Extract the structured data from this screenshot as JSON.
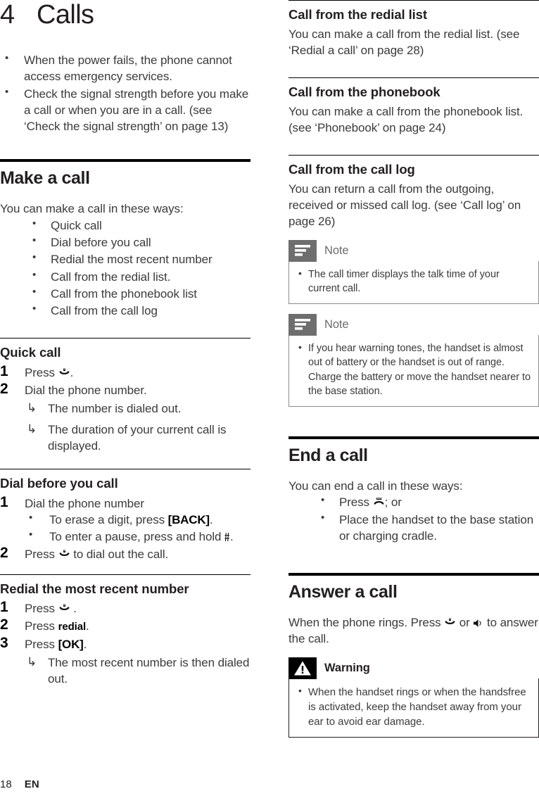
{
  "chapter": {
    "number": "4",
    "title": "Calls"
  },
  "intro_bullets": [
    "When the power fails, the phone cannot access emergency services.",
    "Check the signal strength before you make a call or when you are in a call. (see ‘Check the signal strength’ on page 13)"
  ],
  "make_a_call": {
    "heading": "Make a call",
    "intro": "You can make a call in these ways:",
    "ways": [
      "Quick call",
      "Dial before you call",
      "Redial the most recent number",
      "Call from the redial list.",
      "Call from the phonebook list",
      "Call from the call log"
    ]
  },
  "quick_call": {
    "heading": "Quick call",
    "step1_num": "1",
    "step1_a": "Press",
    "step1_b": ".",
    "step2_num": "2",
    "step2_text": "Dial the phone number.",
    "results": [
      "The number is dialed out.",
      "The duration of your current call is displayed."
    ]
  },
  "dial_before": {
    "heading": "Dial before you call",
    "step1_num": "1",
    "step1_text": "Dial the phone number",
    "sub1_a": "To erase a digit, press",
    "sub1_key": "[BACK]",
    "sub1_b": ".",
    "sub2_a": "To enter a pause, press and hold",
    "sub2_b": ".",
    "step2_num": "2",
    "step2_a": "Press",
    "step2_b": "to dial out the call."
  },
  "redial_recent": {
    "heading": "Redial the most recent number",
    "step1_num": "1",
    "step1_a": "Press",
    "step1_b": ".",
    "step2_num": "2",
    "step2_a": "Press",
    "step2_softkey": "redial",
    "step2_b": ".",
    "step3_num": "3",
    "step3_a": "Press",
    "step3_key": "[OK]",
    "step3_b": ".",
    "result": "The most recent number is then dialed out."
  },
  "redial_list": {
    "heading": "Call from the redial list",
    "body": "You can make a call from the redial list. (see ‘Redial a call’ on page 28)"
  },
  "phonebook": {
    "heading": "Call from the phonebook",
    "body": "You can make a call from the phonebook list. (see ‘Phonebook’ on page 24)"
  },
  "call_log": {
    "heading": "Call from the call log",
    "body": "You can return a call from the outgoing, received or missed call log. (see ‘Call log’ on page 26)"
  },
  "note1": {
    "label": "Note",
    "items": [
      "The call timer displays the talk time of your current call."
    ]
  },
  "note2": {
    "label": "Note",
    "items": [
      "If you hear warning tones, the handset is almost out of battery or the handset is out of range. Charge the battery or move the handset nearer to the base station."
    ]
  },
  "end_a_call": {
    "heading": "End a call",
    "intro": "You can end a call in these ways:",
    "way1_a": "Press",
    "way1_b": "; or",
    "way2": "Place the handset to the base station or charging cradle."
  },
  "answer_a_call": {
    "heading": "Answer a call",
    "body_a": "When the phone rings. Press",
    "body_or": "or",
    "body_b": "to answer the call."
  },
  "warning": {
    "label": "Warning",
    "items": [
      "When the handset rings or when the handsfree is activated, keep the handset away from your ear to avoid ear damage."
    ]
  },
  "footer": {
    "page": "18",
    "language": "EN"
  },
  "colors": {
    "text": "#3b3b3b",
    "heading": "#231f20",
    "note_badge": "#6e6e6e",
    "note_label": "#6b6b6b",
    "warning_badge": "#000000",
    "box_border": "#8c8c8c"
  },
  "icons": {
    "talk_key": "talk-key-icon",
    "end_key": "end-key-icon",
    "speaker_key": "speakerphone-icon",
    "pause_key": "pause-key-icon",
    "note_badge": "note-lines-icon",
    "warning_badge": "warning-triangle-icon"
  }
}
